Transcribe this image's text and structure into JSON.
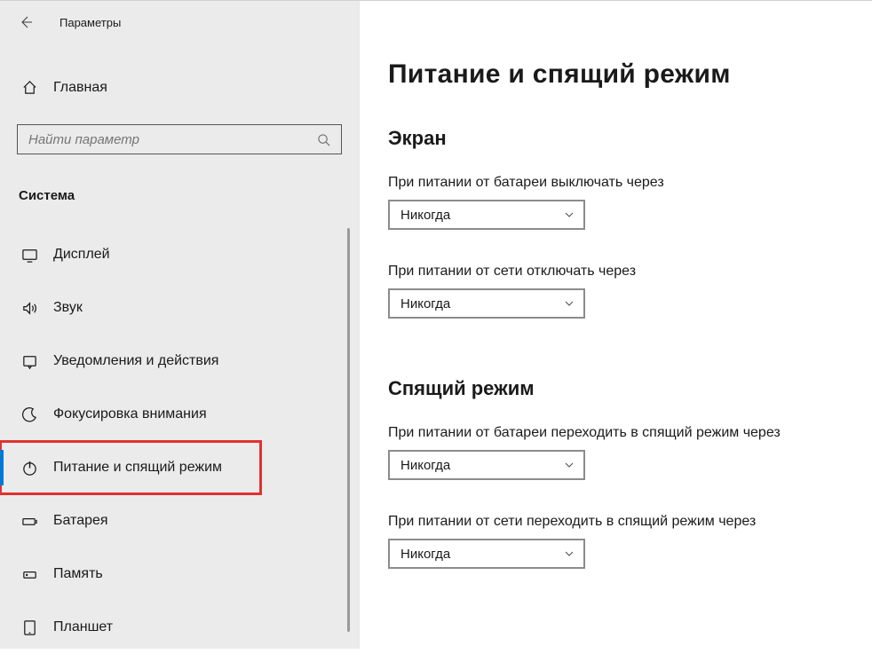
{
  "window": {
    "title": "Параметры"
  },
  "sidebar": {
    "home_label": "Главная",
    "search_placeholder": "Найти параметр",
    "category": "Система",
    "items": [
      {
        "label": "Дисплей"
      },
      {
        "label": "Звук"
      },
      {
        "label": "Уведомления и действия"
      },
      {
        "label": "Фокусировка внимания"
      },
      {
        "label": "Питание и спящий режим"
      },
      {
        "label": "Батарея"
      },
      {
        "label": "Память"
      },
      {
        "label": "Планшет"
      }
    ]
  },
  "main": {
    "title": "Питание и спящий режим",
    "sections": {
      "screen": {
        "heading": "Экран",
        "battery_label": "При питании от батареи выключать через",
        "battery_value": "Никогда",
        "plugged_label": "При питании от сети отключать через",
        "plugged_value": "Никогда"
      },
      "sleep": {
        "heading": "Спящий режим",
        "battery_label": "При питании от батареи переходить в спящий режим через",
        "battery_value": "Никогда",
        "plugged_label": "При питании от сети переходить в спящий режим через",
        "plugged_value": "Никогда"
      }
    }
  }
}
